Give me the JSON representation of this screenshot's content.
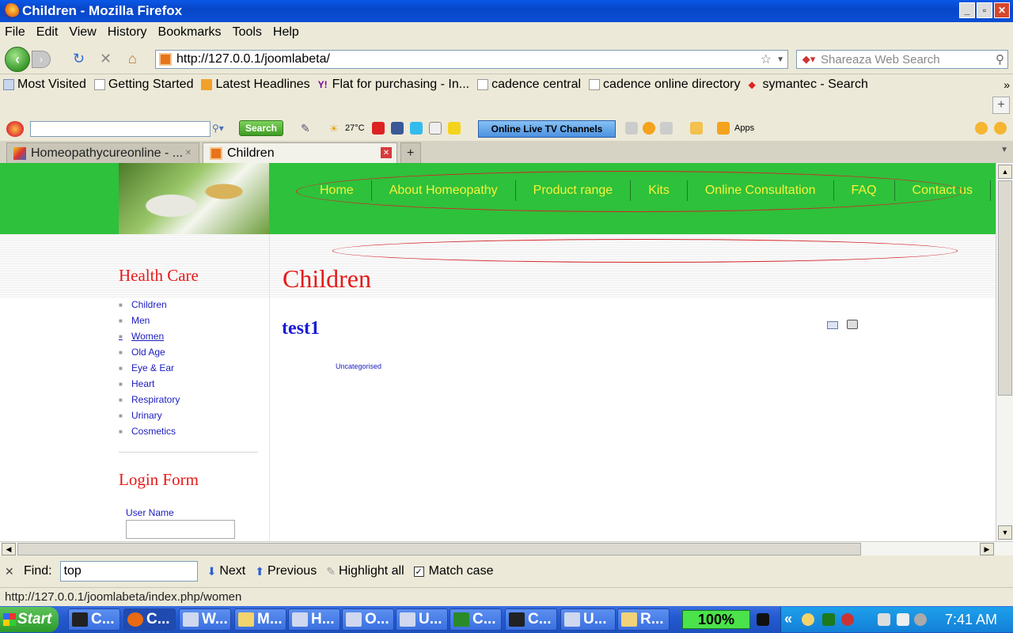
{
  "window": {
    "title": "Children - Mozilla Firefox",
    "min": "_",
    "max": "▫",
    "close": "✕"
  },
  "menu": [
    "File",
    "Edit",
    "View",
    "History",
    "Bookmarks",
    "Tools",
    "Help"
  ],
  "nav": {
    "url": "http://127.0.0.1/joomlabeta/",
    "search_placeholder": "Shareaza Web Search"
  },
  "bookmarks": [
    "Most Visited",
    "Getting Started",
    "Latest Headlines",
    "Flat for purchasing - In...",
    "cadence central",
    "cadence online directory",
    "symantec - Search"
  ],
  "addon": {
    "search_label": "Search",
    "temperature": "27°C",
    "tv_label": "Online Live TV Channels",
    "apps_label": "Apps"
  },
  "tabs": [
    {
      "label": "Homeopathycureonline - ...",
      "active": false
    },
    {
      "label": "Children",
      "active": true
    }
  ],
  "site": {
    "topnav": [
      "Home",
      "About Homeopathy",
      "Product range",
      "Kits",
      "Online Consultation",
      "FAQ",
      "Contact us"
    ],
    "sidebar_title": "Health Care",
    "sidebar_items": [
      "Children",
      "Men",
      "Women",
      "Old Age",
      "Eye & Ear",
      "Heart",
      "Respiratory",
      "Urinary",
      "Cosmetics"
    ],
    "login_title": "Login Form",
    "login_user_label": "User Name",
    "page_title": "Children",
    "article_title": "test1",
    "category": "Uncategorised"
  },
  "find": {
    "label": "Find:",
    "value": "top",
    "next": "Next",
    "previous": "Previous",
    "highlight": "Highlight all",
    "match_case": "Match case",
    "match_case_checked": true
  },
  "status": {
    "text": "http://127.0.0.1/joomlabeta/index.php/women"
  },
  "taskbar": {
    "start": "Start",
    "tasks": [
      "C...",
      "C...",
      "W...",
      "M...",
      "H...",
      "O...",
      "U...",
      "C...",
      "C...",
      "U...",
      "R..."
    ],
    "battery": "100%",
    "clock": "7:41 AM",
    "tray_arrows": "«"
  },
  "colors": {
    "header_green": "#2ec13b",
    "nav_yellow": "#f7f23a",
    "title_red": "#e61a1a",
    "link_blue": "#1b1bbf"
  }
}
